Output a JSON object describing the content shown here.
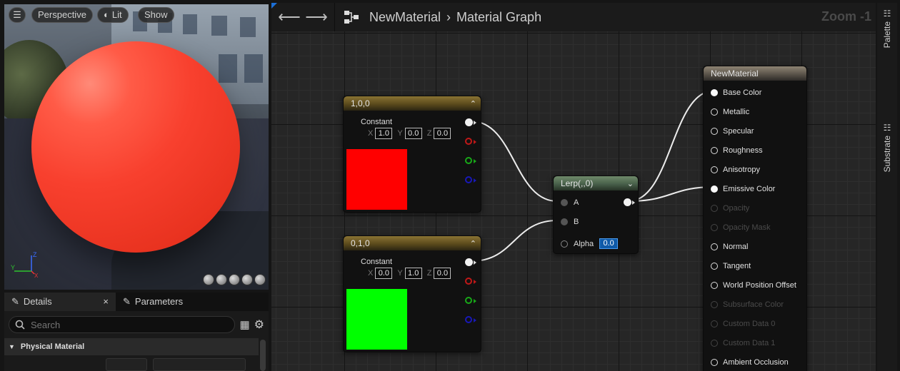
{
  "viewport": {
    "menu_icon": "hamburger-icon",
    "buttons": [
      {
        "label": "Perspective"
      },
      {
        "label": "Lit",
        "icon": "lit-sphere-icon"
      },
      {
        "label": "Show"
      }
    ],
    "axis": {
      "z": "Z",
      "y": "Y",
      "x": "X"
    },
    "preview_shapes": [
      "cylinder-icon",
      "sphere-icon",
      "plane-icon",
      "cube-icon",
      "teapot-icon"
    ]
  },
  "details": {
    "tabs": [
      {
        "label": "Details",
        "close": "×",
        "icon": "pencil-icon"
      },
      {
        "label": "Parameters",
        "icon": "pencil-icon"
      }
    ],
    "search_placeholder": "Search",
    "section_header": "Physical Material"
  },
  "graph": {
    "breadcrumb": {
      "asset": "NewMaterial",
      "separator": "›",
      "graph": "Material Graph"
    },
    "zoom": "Zoom -1",
    "nodes": {
      "red_constant": {
        "title": "1,0,0",
        "label": "Constant",
        "x_label": "X",
        "x": "1.0",
        "y_label": "Y",
        "y": "0.0",
        "z_label": "Z",
        "z": "0.0",
        "color": "#ff0000"
      },
      "green_constant": {
        "title": "0,1,0",
        "label": "Constant",
        "x_label": "X",
        "x": "0.0",
        "y_label": "Y",
        "y": "1.0",
        "z_label": "Z",
        "z": "0.0",
        "color": "#00ff00"
      },
      "lerp": {
        "title": "Lerp(,,0)",
        "pin_a": "A",
        "pin_b": "B",
        "pin_alpha": "Alpha",
        "alpha_value": "0.0"
      },
      "result": {
        "title": "NewMaterial",
        "pins": [
          {
            "label": "Base Color",
            "connected": true,
            "enabled": true
          },
          {
            "label": "Metallic",
            "connected": false,
            "enabled": true
          },
          {
            "label": "Specular",
            "connected": false,
            "enabled": true
          },
          {
            "label": "Roughness",
            "connected": false,
            "enabled": true
          },
          {
            "label": "Anisotropy",
            "connected": false,
            "enabled": true
          },
          {
            "label": "Emissive Color",
            "connected": true,
            "enabled": true
          },
          {
            "label": "Opacity",
            "connected": false,
            "enabled": false
          },
          {
            "label": "Opacity Mask",
            "connected": false,
            "enabled": false
          },
          {
            "label": "Normal",
            "connected": false,
            "enabled": true
          },
          {
            "label": "Tangent",
            "connected": false,
            "enabled": true
          },
          {
            "label": "World Position Offset",
            "connected": false,
            "enabled": true
          },
          {
            "label": "Subsurface Color",
            "connected": false,
            "enabled": false
          },
          {
            "label": "Custom Data 0",
            "connected": false,
            "enabled": false
          },
          {
            "label": "Custom Data 1",
            "connected": false,
            "enabled": false
          },
          {
            "label": "Ambient Occlusion",
            "connected": false,
            "enabled": true
          }
        ]
      }
    },
    "pin_colors": {
      "white": "#f2f2f2",
      "red": "#c01818",
      "green": "#18a818",
      "blue": "#1818b8"
    }
  },
  "side_rail": [
    {
      "label": "Palette",
      "icon": "list-icon"
    },
    {
      "label": "Substrate",
      "icon": "list-icon"
    }
  ]
}
